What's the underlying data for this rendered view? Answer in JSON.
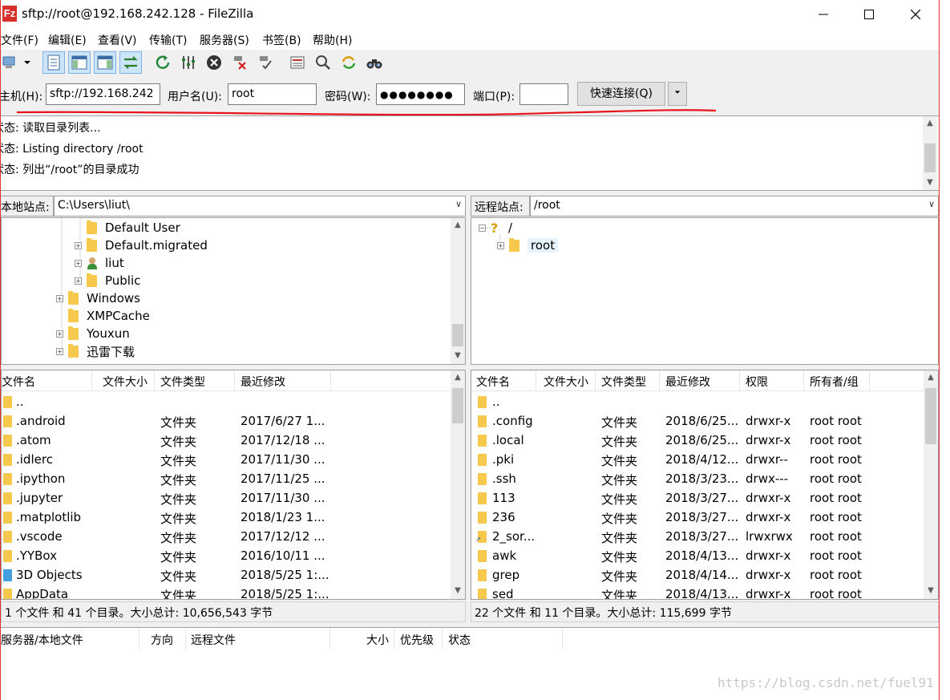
{
  "window": {
    "title": "sftp://root@192.168.242.128 - FileZilla",
    "app_icon_letter": "Fz",
    "controls": {
      "minimize": "—",
      "maximize": "☐",
      "close": "✕"
    }
  },
  "menu": [
    "文件(F)",
    "编辑(E)",
    "查看(V)",
    "传输(T)",
    "服务器(S)",
    "书签(B)",
    "帮助(H)"
  ],
  "quickconnect": {
    "host_label": "主机(H):",
    "host_value": "sftp://192.168.242",
    "user_label": "用户名(U):",
    "user_value": "root",
    "pass_label": "密码(W):",
    "pass_value": "●●●●●●●●",
    "port_label": "端口(P):",
    "port_value": "",
    "connect_label": "快速连接(Q)",
    "dropdown_glyph": "▼"
  },
  "log": [
    {
      "prefix": "状态:",
      "text": "读取目录列表..."
    },
    {
      "prefix": "状态:",
      "text": "Listing directory /root"
    },
    {
      "prefix": "状态:",
      "text": "列出“/root”的目录成功"
    }
  ],
  "local": {
    "site_label": "本地站点:",
    "path": "C:\\Users\\liut\\",
    "tree": [
      {
        "label": "Default User",
        "icon": "folder",
        "expander": "none",
        "level": 2
      },
      {
        "label": "Default.migrated",
        "icon": "folder",
        "expander": "+",
        "level": 2
      },
      {
        "label": "liut",
        "icon": "user",
        "expander": "+",
        "level": 2
      },
      {
        "label": "Public",
        "icon": "folder",
        "expander": "+",
        "level": 2
      },
      {
        "label": "Windows",
        "icon": "folder",
        "expander": "+",
        "level": 1
      },
      {
        "label": "XMPCache",
        "icon": "folder",
        "expander": "none",
        "level": 1
      },
      {
        "label": "Youxun",
        "icon": "folder",
        "expander": "+",
        "level": 1
      },
      {
        "label": "迅雷下载",
        "icon": "folder",
        "expander": "+",
        "level": 1
      }
    ],
    "columns": [
      "文件名",
      "文件大小",
      "文件类型",
      "最近修改"
    ],
    "rows": [
      {
        "name": "..",
        "size": "",
        "type": "",
        "modified": "",
        "icon": "folder"
      },
      {
        "name": ".android",
        "size": "",
        "type": "文件夹",
        "modified": "2017/6/27 1...",
        "icon": "folder"
      },
      {
        "name": ".atom",
        "size": "",
        "type": "文件夹",
        "modified": "2017/12/18 ...",
        "icon": "folder"
      },
      {
        "name": ".idlerc",
        "size": "",
        "type": "文件夹",
        "modified": "2017/11/30 ...",
        "icon": "folder"
      },
      {
        "name": ".ipython",
        "size": "",
        "type": "文件夹",
        "modified": "2017/11/25 ...",
        "icon": "folder"
      },
      {
        "name": ".jupyter",
        "size": "",
        "type": "文件夹",
        "modified": "2017/11/30 ...",
        "icon": "folder"
      },
      {
        "name": ".matplotlib",
        "size": "",
        "type": "文件夹",
        "modified": "2018/1/23 1...",
        "icon": "folder"
      },
      {
        "name": ".vscode",
        "size": "",
        "type": "文件夹",
        "modified": "2017/12/12 ...",
        "icon": "folder"
      },
      {
        "name": ".YYBox",
        "size": "",
        "type": "文件夹",
        "modified": "2016/10/11 ...",
        "icon": "folder"
      },
      {
        "name": "3D Objects",
        "size": "",
        "type": "文件夹",
        "modified": "2018/5/25 1:...",
        "icon": "obj"
      },
      {
        "name": "AppData",
        "size": "",
        "type": "文件夹",
        "modified": "2018/5/25 1:...",
        "icon": "folder"
      }
    ],
    "status": "1 个文件 和 41 个目录。大小总计: 10,656,543 字节"
  },
  "remote": {
    "site_label": "远程站点:",
    "path": "/root",
    "tree": [
      {
        "label": "/",
        "icon": "question",
        "expander": "-",
        "level": 0
      },
      {
        "label": "root",
        "icon": "folder",
        "expander": "+",
        "level": 1
      }
    ],
    "columns": [
      "文件名",
      "文件大小",
      "文件类型",
      "最近修改",
      "权限",
      "所有者/组"
    ],
    "rows": [
      {
        "name": "..",
        "type": "",
        "modified": "",
        "perm": "",
        "owner": "",
        "icon": "folder"
      },
      {
        "name": ".config",
        "type": "文件夹",
        "modified": "2018/6/25...",
        "perm": "drwxr-x",
        "owner": "root root",
        "icon": "folder"
      },
      {
        "name": ".local",
        "type": "文件夹",
        "modified": "2018/6/25...",
        "perm": "drwxr-x",
        "owner": "root root",
        "icon": "folder"
      },
      {
        "name": ".pki",
        "type": "文件夹",
        "modified": "2018/4/12...",
        "perm": "drwxr--",
        "owner": "root root",
        "icon": "folder"
      },
      {
        "name": ".ssh",
        "type": "文件夹",
        "modified": "2018/3/23...",
        "perm": "drwx---",
        "owner": "root root",
        "icon": "folder"
      },
      {
        "name": "113",
        "type": "文件夹",
        "modified": "2018/3/27...",
        "perm": "drwxr-x",
        "owner": "root root",
        "icon": "folder"
      },
      {
        "name": "236",
        "type": "文件夹",
        "modified": "2018/3/27...",
        "perm": "drwxr-x",
        "owner": "root root",
        "icon": "folder"
      },
      {
        "name": "2_sor...",
        "type": "文件夹",
        "modified": "2018/3/27...",
        "perm": "lrwxrwx",
        "owner": "root root",
        "icon": "link"
      },
      {
        "name": "awk",
        "type": "文件夹",
        "modified": "2018/4/13...",
        "perm": "drwxr-x",
        "owner": "root root",
        "icon": "folder"
      },
      {
        "name": "grep",
        "type": "文件夹",
        "modified": "2018/4/14...",
        "perm": "drwxr-x",
        "owner": "root root",
        "icon": "folder"
      },
      {
        "name": "sed",
        "type": "文件夹",
        "modified": "2018/4/13...",
        "perm": "drwxr-x",
        "owner": "root root",
        "icon": "folder"
      }
    ],
    "status": "22 个文件 和 11 个目录。大小总计: 115,699 字节"
  },
  "queue": {
    "columns": [
      "服务器/本地文件",
      "方向",
      "远程文件",
      "大小",
      "优先级",
      "状态"
    ]
  },
  "watermark": "https://blog.csdn.net/fuel91",
  "colors": {
    "annotation_red": "#e8141c",
    "folder": "#f6c94c",
    "selection": "#cce4f7"
  }
}
